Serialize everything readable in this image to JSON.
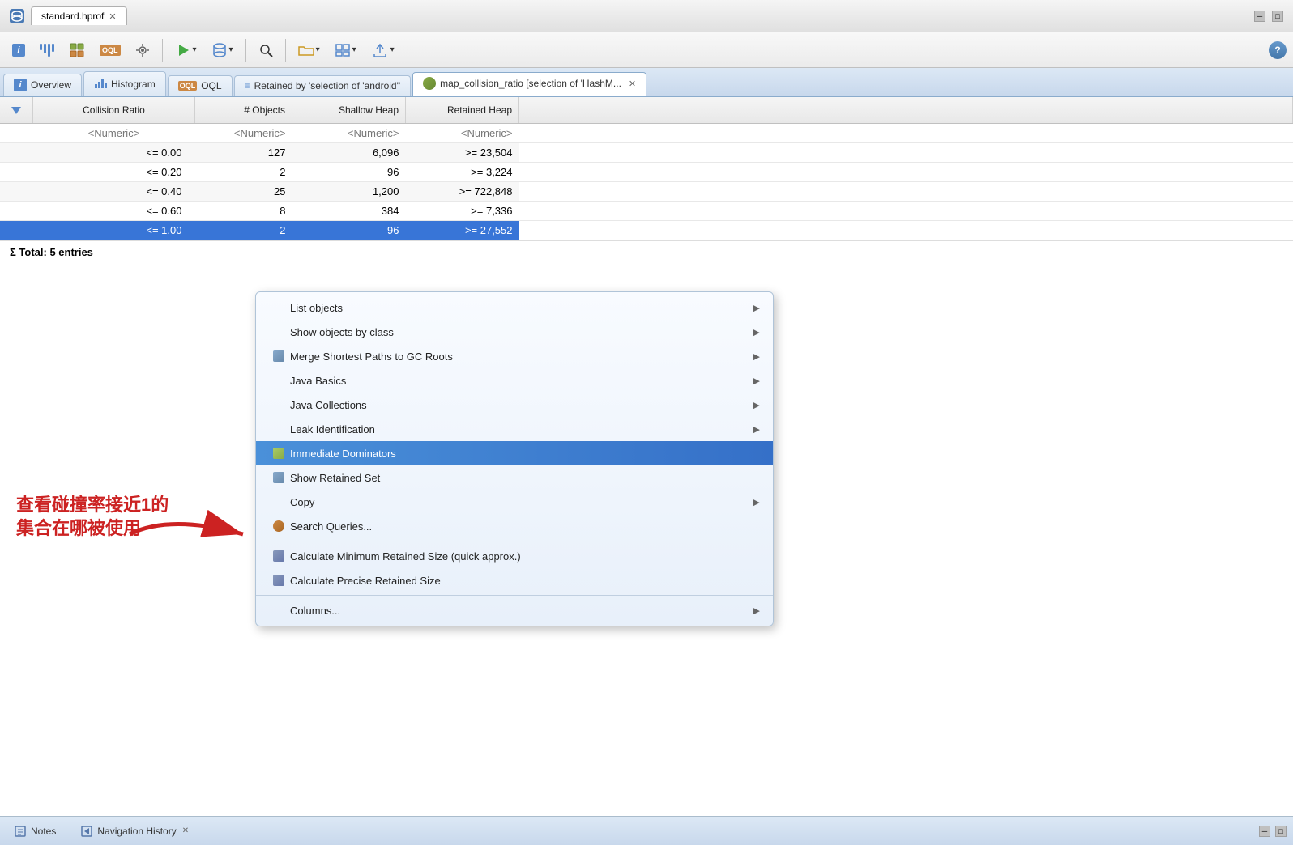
{
  "window": {
    "title": "standard.hprof",
    "title_icon": "db",
    "close_symbol": "✕"
  },
  "toolbar": {
    "help_label": "?"
  },
  "tabs": [
    {
      "id": "overview",
      "label": "Overview",
      "icon": "i",
      "active": false
    },
    {
      "id": "histogram",
      "label": "Histogram",
      "icon": "hist",
      "active": false
    },
    {
      "id": "oql",
      "label": "OQL",
      "icon": "oql",
      "active": false
    },
    {
      "id": "retained",
      "label": "Retained by 'selection of 'android''",
      "icon": "ret",
      "active": false
    },
    {
      "id": "map_collision",
      "label": "map_collision_ratio [selection of 'HashM...",
      "icon": "map",
      "active": true,
      "closable": true
    }
  ],
  "table": {
    "columns": [
      {
        "id": "sort",
        "label": ""
      },
      {
        "id": "collision_ratio",
        "label": "Collision Ratio"
      },
      {
        "id": "objects",
        "label": "# Objects"
      },
      {
        "id": "shallow_heap",
        "label": "Shallow Heap"
      },
      {
        "id": "retained_heap",
        "label": "Retained Heap"
      }
    ],
    "placeholder_row": {
      "col1": "<Numeric>",
      "col2": "<Numeric>",
      "col3": "<Numeric>",
      "col4": "<Numeric>"
    },
    "rows": [
      {
        "ratio": "<= 0.00",
        "objects": "127",
        "shallow": "6,096",
        "retained": ">= 23,504",
        "selected": false
      },
      {
        "ratio": "<= 0.20",
        "objects": "2",
        "shallow": "96",
        "retained": ">= 3,224",
        "selected": false
      },
      {
        "ratio": "<= 0.40",
        "objects": "25",
        "shallow": "1,200",
        "retained": ">= 722,848",
        "selected": false
      },
      {
        "ratio": "<= 0.60",
        "objects": "8",
        "shallow": "384",
        "retained": ">= 7,336",
        "selected": false
      },
      {
        "ratio": "<= 1.00",
        "objects": "2",
        "shallow": "96",
        "retained": ">= 27,552",
        "selected": true
      }
    ],
    "total_label": "Σ Total: 5 entries"
  },
  "context_menu": {
    "items": [
      {
        "id": "list-objects",
        "label": "List objects",
        "has_submenu": true,
        "icon": null
      },
      {
        "id": "show-objects-class",
        "label": "Show objects by class",
        "has_submenu": true,
        "icon": null
      },
      {
        "id": "merge-shortest",
        "label": "Merge Shortest Paths to GC Roots",
        "has_submenu": true,
        "icon": "merge"
      },
      {
        "id": "java-basics",
        "label": "Java Basics",
        "has_submenu": true,
        "icon": null
      },
      {
        "id": "java-collections",
        "label": "Java Collections",
        "has_submenu": true,
        "icon": null
      },
      {
        "id": "leak-identification",
        "label": "Leak Identification",
        "has_submenu": true,
        "icon": null
      },
      {
        "id": "immediate-dominators",
        "label": "Immediate Dominators",
        "has_submenu": false,
        "icon": "immediate",
        "highlighted": true
      },
      {
        "id": "show-retained-set",
        "label": "Show Retained Set",
        "has_submenu": false,
        "icon": "retained"
      },
      {
        "id": "copy",
        "label": "Copy",
        "has_submenu": true,
        "icon": null
      },
      {
        "id": "search-queries",
        "label": "Search Queries...",
        "has_submenu": false,
        "icon": "search"
      },
      {
        "separator": true
      },
      {
        "id": "calc-min-retained",
        "label": "Calculate Minimum Retained Size (quick approx.)",
        "has_submenu": false,
        "icon": "calc"
      },
      {
        "id": "calc-precise-retained",
        "label": "Calculate Precise Retained Size",
        "has_submenu": false,
        "icon": "calc"
      },
      {
        "separator2": true
      },
      {
        "id": "columns",
        "label": "Columns...",
        "has_submenu": true,
        "icon": null
      }
    ]
  },
  "annotation": {
    "text_line1": "查看碰撞率接近1的",
    "text_line2": "集合在哪被使用"
  },
  "bottom_bar": {
    "notes_label": "Notes",
    "nav_label": "Navigation History",
    "nav_close": "✕"
  }
}
